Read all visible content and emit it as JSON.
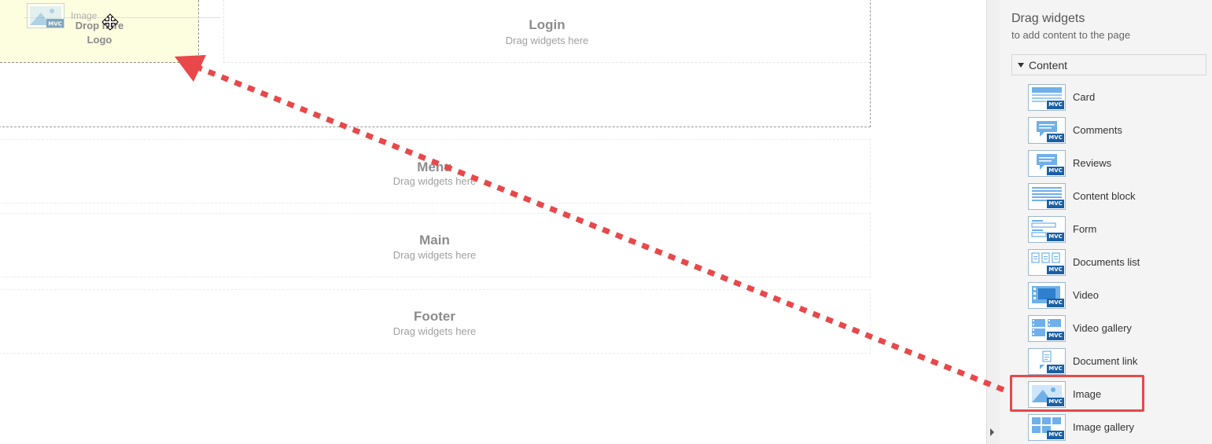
{
  "canvas": {
    "logo_zone": {
      "drop_label_line1": "Drop here",
      "drop_label_line2": "Logo"
    },
    "drag_ghost": {
      "label": "Image",
      "icon": "image-widget-icon"
    },
    "login_zone": {
      "title": "Login",
      "subtitle": "Drag widgets here"
    },
    "menu_zone": {
      "title": "Menu",
      "subtitle": "Drag widgets here"
    },
    "main_zone": {
      "title": "Main",
      "subtitle": "Drag widgets here"
    },
    "footer_zone": {
      "title": "Footer",
      "subtitle": "Drag widgets here"
    }
  },
  "panel": {
    "title": "Drag widgets",
    "subtitle": "to add content to the page",
    "category": "Content",
    "widgets": [
      {
        "label": "Card",
        "icon": "card-icon"
      },
      {
        "label": "Comments",
        "icon": "comments-icon"
      },
      {
        "label": "Reviews",
        "icon": "reviews-icon"
      },
      {
        "label": "Content block",
        "icon": "content-block-icon"
      },
      {
        "label": "Form",
        "icon": "form-icon"
      },
      {
        "label": "Documents list",
        "icon": "documents-list-icon"
      },
      {
        "label": "Video",
        "icon": "video-icon"
      },
      {
        "label": "Video gallery",
        "icon": "video-gallery-icon"
      },
      {
        "label": "Document link",
        "icon": "document-link-icon"
      },
      {
        "label": "Image",
        "icon": "image-icon"
      },
      {
        "label": "Image gallery",
        "icon": "image-gallery-icon"
      }
    ],
    "badge_text": "MVC",
    "highlighted_widget": "Image"
  },
  "colors": {
    "accent": "#1a5fa6",
    "icon_light": "#6fb0e8",
    "arrow": "#e8484a",
    "drop_zone_bg": "#fdfde0"
  }
}
